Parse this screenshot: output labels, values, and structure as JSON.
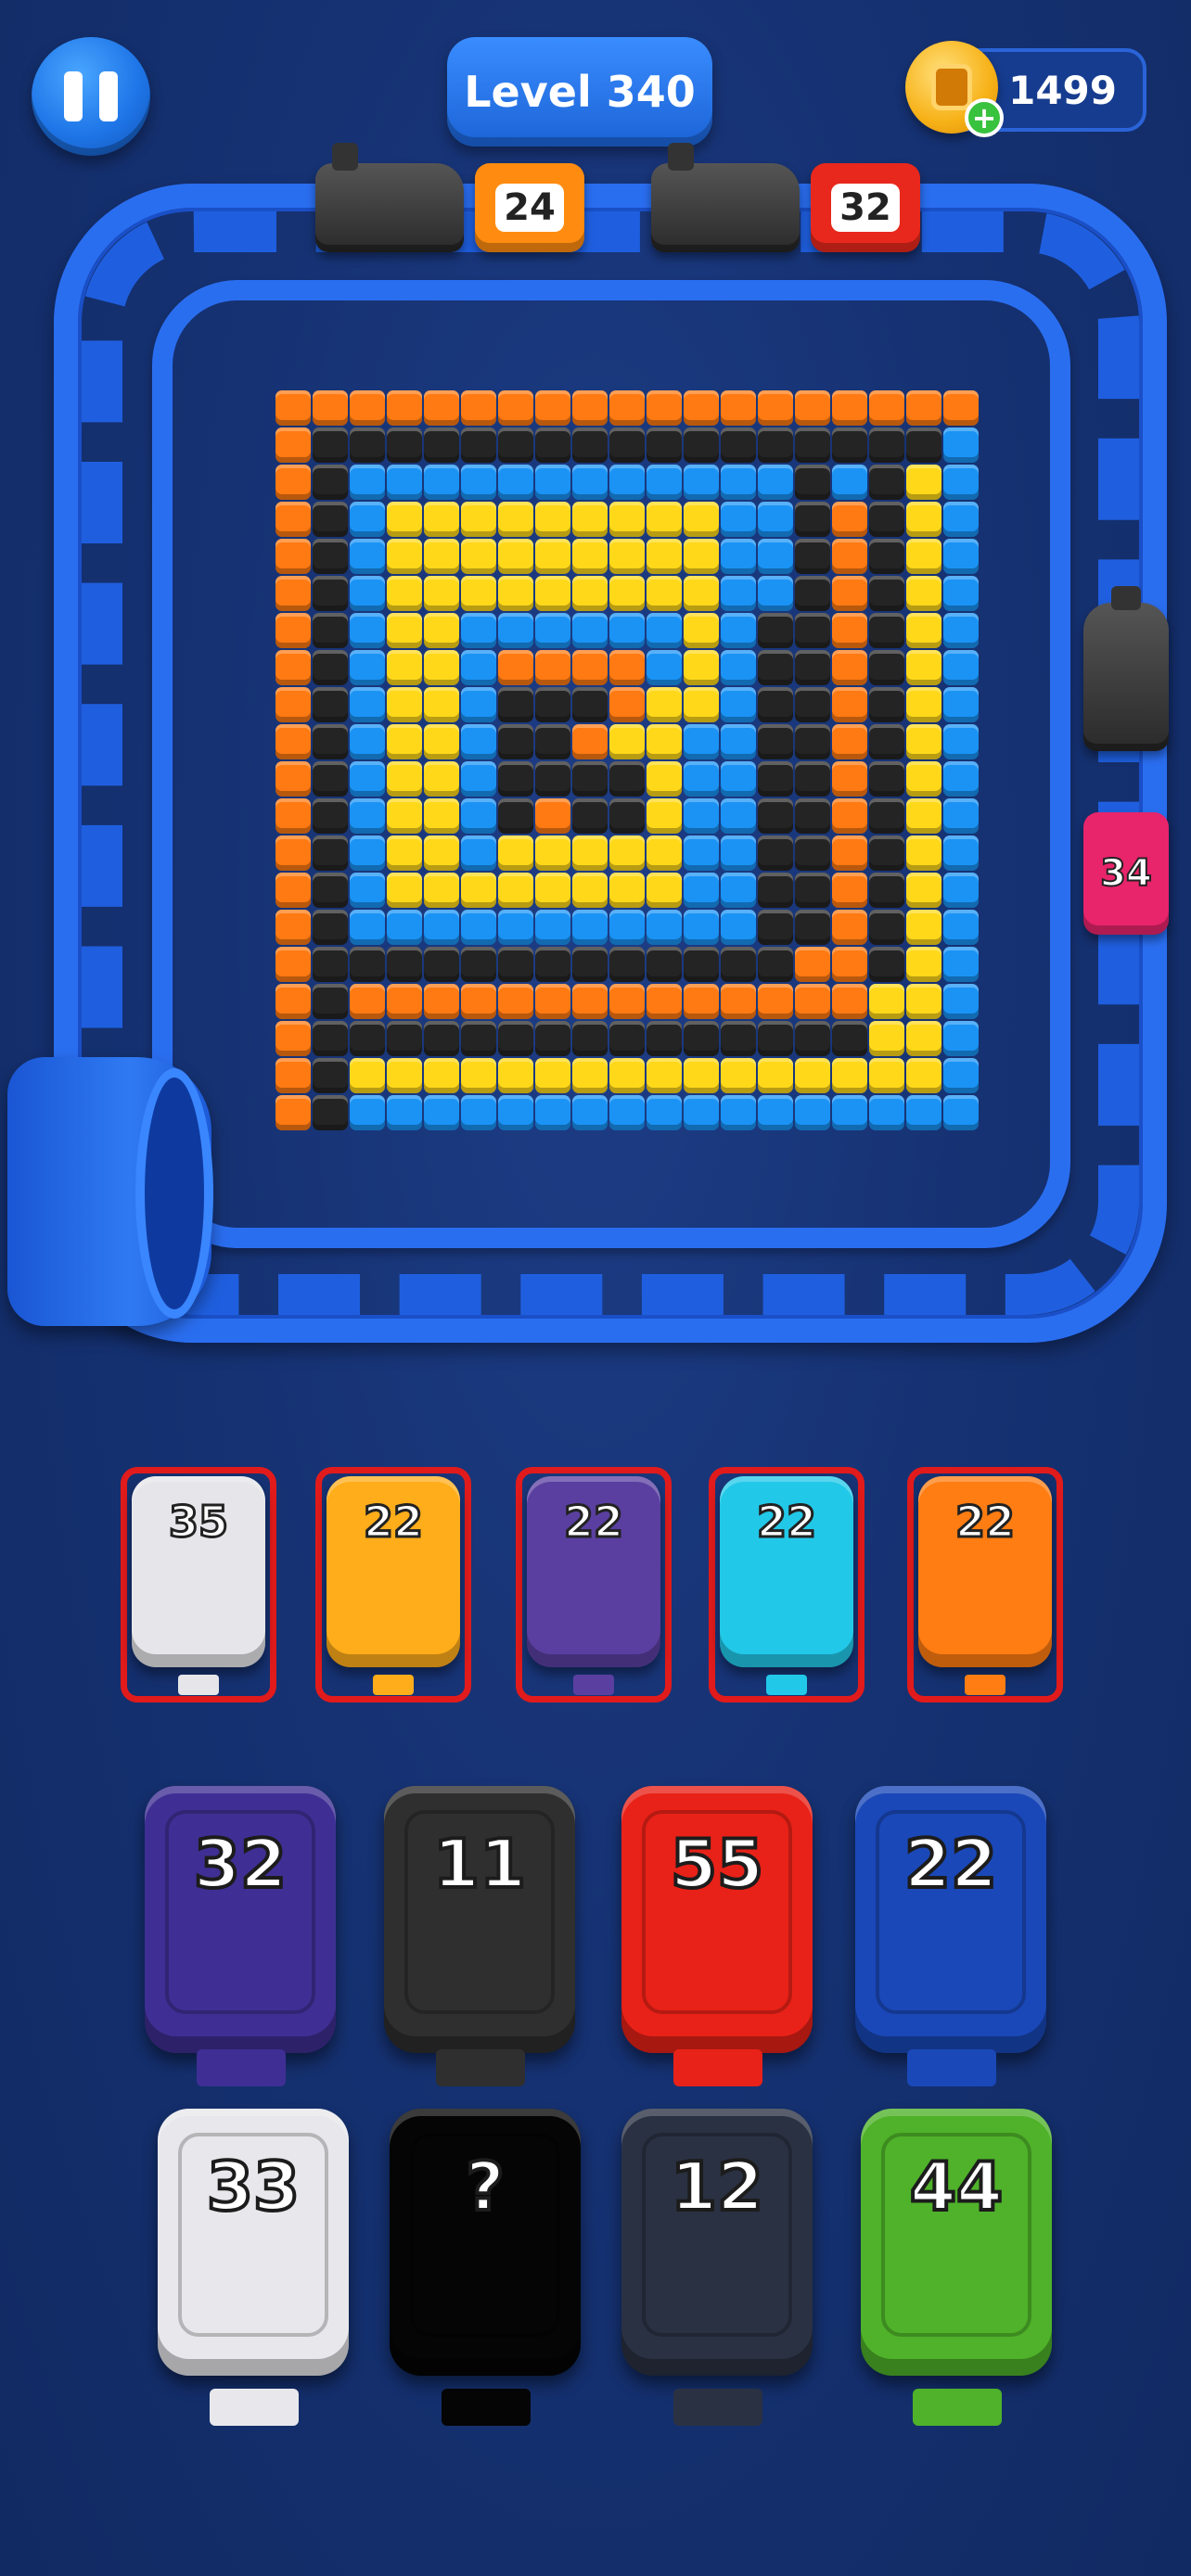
{
  "hud": {
    "level_label": "Level 340",
    "coins": "1499"
  },
  "track_trains": [
    {
      "number": "24",
      "color": "#ff8c10"
    },
    {
      "number": "32",
      "color": "#e8281c"
    },
    {
      "number": "34",
      "color": "#e8246b"
    }
  ],
  "queue_slots": [
    {
      "number": "35",
      "color": "#e6e6ea"
    },
    {
      "number": "22",
      "color": "#ffad1a"
    },
    {
      "number": "22",
      "color": "#5a3fa0"
    },
    {
      "number": "22",
      "color": "#22c8e8"
    },
    {
      "number": "22",
      "color": "#ff7d12"
    }
  ],
  "yard_row1": [
    {
      "number": "32",
      "color": "#3f2f94"
    },
    {
      "number": "11",
      "color": "#2f2f2f"
    },
    {
      "number": "55",
      "color": "#e82218"
    },
    {
      "number": "22",
      "color": "#1a48b8"
    }
  ],
  "yard_row2": [
    {
      "number": "33",
      "color": "#e8e8ec"
    },
    {
      "number": "?",
      "color": "#050505"
    },
    {
      "number": "12",
      "color": "#2a3142"
    },
    {
      "number": "44",
      "color": "#4fb22a"
    }
  ],
  "grid_rows": [
    "ooooooooooooooooooo",
    "okkkkkkkkkkkkkkkkkb",
    "okbbbbbbbbbbbbkbkyb",
    "okbyyyyyyyyybbkokyb",
    "okbyyyyyyyyybbkokyb",
    "okbyyyyyyyyybbkokyb",
    "okbyybbbbbbybkkokyb",
    "okbyyboooobybkkokyb",
    "okbyybkkkoyybkkokyb",
    "okbyybkkoyybbkkokyb",
    "okbyybkkkkybbkkokyb",
    "okbyybkokkybbkkokyb",
    "okbyybyyyyybbkkokyb",
    "okbyyyyyyyybbkkokyb",
    "okbbbbbbbbbbbkkokyb",
    "okkkkkkkkkkkkkookyb",
    "okooooooooooooooyyb",
    "okkkkkkkkkkkkkkkyyb",
    "okyyyyyyyyyyyyyyyyb",
    "okbbbbbbbbbbbbbbbbb"
  ]
}
